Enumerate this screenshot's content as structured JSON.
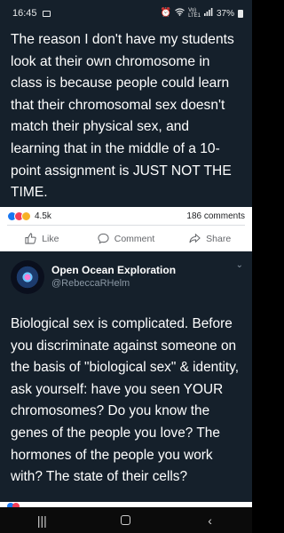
{
  "status_bar": {
    "time": "16:45",
    "network_top": "Vo)",
    "network_bottom": "LTE1",
    "battery": "37%"
  },
  "post_top": {
    "text": "The reason I don't have my students look at their own chromosome in class is because people could learn that their chromosomal sex doesn't match their physical sex, and learning that in the middle of a 10-point assignment is JUST NOT THE TIME."
  },
  "fb_actions": {
    "reaction_count": "4.5k",
    "comments_count": "186 comments",
    "like_label": "Like",
    "comment_label": "Comment",
    "share_label": "Share"
  },
  "post_bottom": {
    "author_name": "Open Ocean Exploration",
    "author_handle": "@RebeccaRHelm",
    "text": "Biological sex is complicated. Before you discriminate against someone on the basis of \"biological sex\" & identity, ask yourself: have you seen YOUR chromosomes? Do you know the genes of the people you love? The hormones of the people you work with? The state of their cells?"
  },
  "colors": {
    "dark_bg": "#15202b",
    "fb_like_blue": "#1877f2",
    "fb_love_red": "#f33e58",
    "fb_haha_yellow": "#f7b125"
  },
  "nav": {
    "recents_icon": "recents-icon",
    "home_icon": "home-icon",
    "back_icon": "back-icon"
  }
}
